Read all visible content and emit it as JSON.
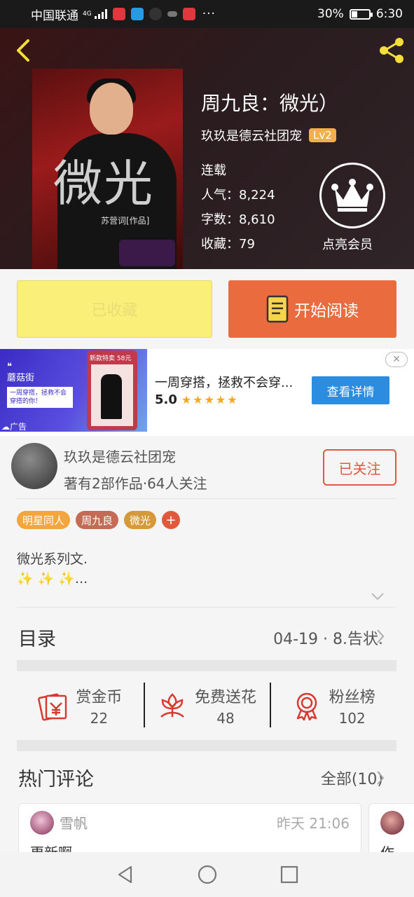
{
  "status_bar": {
    "carrier": "中国联通",
    "network": "4G",
    "battery": "30%",
    "time": "6:30",
    "more": "···"
  },
  "book": {
    "title": "周九良：微光）",
    "author": "玖玖是德云社团宠",
    "level": "Lv2",
    "status": "连载",
    "popularity": "人气：8,224",
    "word_count": "字数：8,610",
    "favorites": "收藏：79",
    "vip_label": "点亮会员",
    "cover_title": "微光",
    "cover_subtitle": "苏营词[作品]"
  },
  "buttons": {
    "favorited": "已收藏",
    "start_reading": "开始阅读"
  },
  "ad": {
    "brand": "蘑菇街",
    "note": "一周穿搭，拯救不会穿搭的你！",
    "tag": "广告",
    "title": "一周穿搭，拯救不会穿...",
    "rating": "5.0",
    "stars": "★★★★★",
    "cta": "查看详情",
    "close": "✕",
    "phone_banner": "新款特卖 58元"
  },
  "author_card": {
    "name": "玖玖是德云社团宠",
    "summary": "著有2部作品·64人关注",
    "follow": "已关注"
  },
  "tags": [
    {
      "label": "明星同人",
      "color": "#f3a63d"
    },
    {
      "label": "周九良",
      "color": "#c56a55"
    },
    {
      "label": "微光",
      "color": "#d4993a"
    }
  ],
  "tag_add": "+",
  "description": {
    "line1": "微光系列文.",
    "line2": "✨ ✨ ✨..."
  },
  "catalog": {
    "title": "目录",
    "latest": "04-19 · 8.告状."
  },
  "actions": [
    {
      "label": "赏金币",
      "value": "22",
      "icon": "red-envelope-icon"
    },
    {
      "label": "免费送花",
      "value": "48",
      "icon": "flower-icon"
    },
    {
      "label": "粉丝榜",
      "value": "102",
      "icon": "medal-icon"
    }
  ],
  "comments": {
    "title": "热门评论",
    "all": "全部(10)",
    "items": [
      {
        "user": "雪帆",
        "time": "昨天 21:06",
        "text": "更新啊"
      },
      {
        "user": "",
        "time": "",
        "text": "作"
      }
    ]
  },
  "colors": {
    "accent": "#ea6b3e",
    "fav_bg": "#faf079",
    "ad_blue": "#2c8ce0",
    "follow_red": "#e05840"
  }
}
